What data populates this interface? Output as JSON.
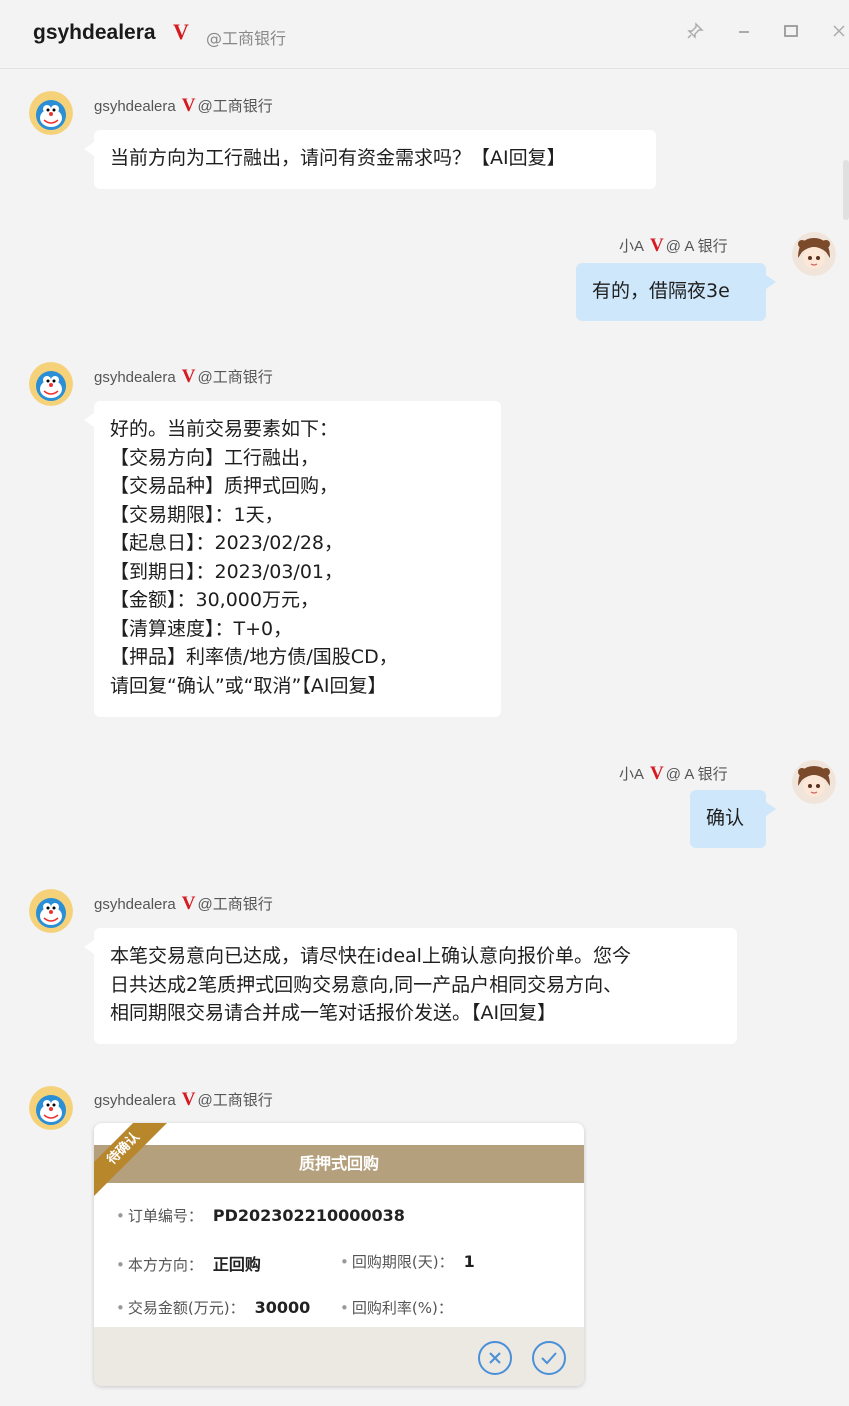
{
  "window": {
    "title": "gsyhdealera",
    "verified_mark": "V",
    "org": "@工商银行"
  },
  "icons": {
    "pin": "pin-icon",
    "minimize": "minimize-icon",
    "maximize": "maximize-icon",
    "close": "close-icon",
    "cancel": "cancel-icon",
    "confirm": "confirm-icon"
  },
  "colors": {
    "verified": "#d71920",
    "self_bubble": "#cfe7fb",
    "card_header": "#b5a07e",
    "ribbon": "#b8862b",
    "action_blue": "#4a90d9"
  },
  "messages": [
    {
      "sender": "gsyhdealera",
      "mark": "V",
      "org": "@工商银行",
      "lines": [
        "当前方向为工行融出，请问有资金需求吗？【AI回复】"
      ]
    },
    {
      "sender": "小A",
      "mark": "V",
      "org": "@ A 银行",
      "lines": [
        "有的，借隔夜3e"
      ]
    },
    {
      "sender": "gsyhdealera",
      "mark": "V",
      "org": "@工商银行",
      "lines": [
        "好的。当前交易要素如下：",
        "【交易方向】工行融出，",
        "【交易品种】质押式回购，",
        "【交易期限】：1天，",
        "【起息日】：2023/02/28，",
        "【到期日】：2023/03/01，",
        "【金额】：30,000万元，",
        "【清算速度】：T+0，",
        "【押品】利率债/地方债/国股CD，",
        "请回复“确认”或“取消”【AI回复】"
      ]
    },
    {
      "sender": "小A",
      "mark": "V",
      "org": "@ A 银行",
      "lines": [
        "确认"
      ]
    },
    {
      "sender": "gsyhdealera",
      "mark": "V",
      "org": "@工商银行",
      "lines": [
        "本笔交易意向已达成，请尽快在ideal上确认意向报价单。您今",
        "日共达成2笔质押式回购交易意向,同一产品户相同交易方向、",
        "相同期限交易请合并成一笔对话报价发送。【AI回复】"
      ]
    },
    {
      "sender": "gsyhdealera",
      "mark": "V",
      "org": "@工商银行"
    }
  ],
  "card": {
    "ribbon": "待确认",
    "title": "质押式回购",
    "order_label": "订单编号：",
    "order_value": "PD202302210000038",
    "direction_label": "本方方向：",
    "direction_value": "正回购",
    "term_label": "回购期限(天)：",
    "term_value": "1",
    "amount_label": "交易金额(万元)：",
    "amount_value": "30000",
    "rate_label": "回购利率(%)：",
    "rate_value": ""
  }
}
